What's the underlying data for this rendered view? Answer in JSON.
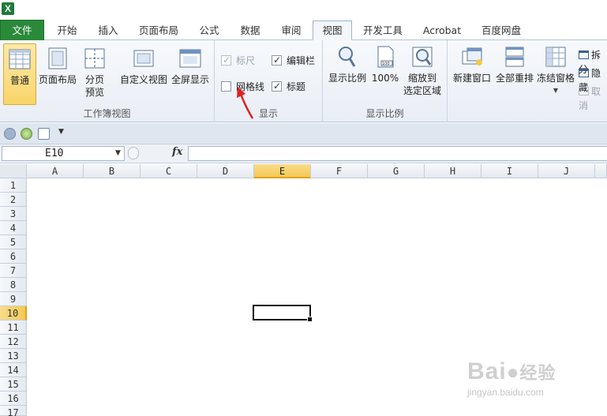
{
  "titlebar": {
    "app_icon": "excel-icon"
  },
  "tabs": [
    {
      "label": "文件",
      "type": "file"
    },
    {
      "label": "开始"
    },
    {
      "label": "插入"
    },
    {
      "label": "页面布局"
    },
    {
      "label": "公式"
    },
    {
      "label": "数据"
    },
    {
      "label": "审阅"
    },
    {
      "label": "视图",
      "active": true
    },
    {
      "label": "开发工具"
    },
    {
      "label": "Acrobat"
    },
    {
      "label": "百度网盘"
    }
  ],
  "ribbon": {
    "workbook_views": {
      "label": "工作簿视图",
      "normal": "普通",
      "page_layout": "页面布局",
      "page_break_1": "分页",
      "page_break_2": "预览",
      "custom_views": "自定义视图",
      "full_screen": "全屏显示"
    },
    "show": {
      "label": "显示",
      "ruler": "标尺",
      "formula_bar": "编辑栏",
      "gridlines": "网格线",
      "headings": "标题",
      "ruler_checked": true,
      "formula_bar_checked": true,
      "gridlines_checked": false,
      "headings_checked": true
    },
    "zoom": {
      "label": "显示比例",
      "zoom": "显示比例",
      "hundred": "100%",
      "hundred_icon_text": "100",
      "zoom_selection_1": "缩放到",
      "zoom_selection_2": "选定区域"
    },
    "window": {
      "new_window": "新建窗口",
      "arrange_all": "全部重排",
      "freeze_panes": "冻结窗格",
      "split": "拆分",
      "hide": "隐藏",
      "unhide": "取消"
    }
  },
  "formula_bar": {
    "name_box": "E10",
    "fx": "fx",
    "content": ""
  },
  "grid": {
    "columns": [
      "A",
      "B",
      "C",
      "D",
      "E",
      "F",
      "G",
      "H",
      "I",
      "J"
    ],
    "rows": [
      "1",
      "2",
      "3",
      "4",
      "5",
      "6",
      "7",
      "8",
      "9",
      "10",
      "11",
      "12",
      "13",
      "14",
      "15",
      "16",
      "17"
    ],
    "selected_column": "E",
    "selected_row": "10",
    "active_cell": "E10"
  },
  "watermark": {
    "logo": "Bai",
    "logo_suffix": "经验",
    "url": "jingyan.baidu.com"
  },
  "colors": {
    "file_tab": "#2a8a3a",
    "selected_header": "#f3c955",
    "annotation_arrow": "#e02020"
  }
}
